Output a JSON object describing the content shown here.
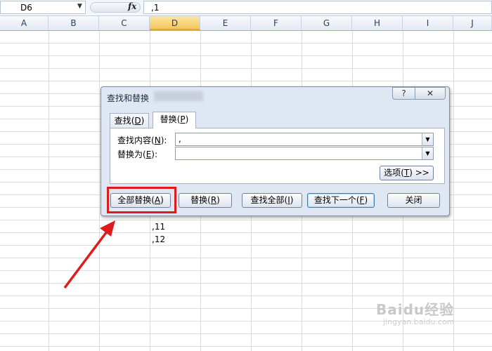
{
  "formula_bar": {
    "name_box": "D6",
    "fx_icon": "function-icon",
    "formula": ",1"
  },
  "columns": [
    "A",
    "B",
    "C",
    "D",
    "E",
    "F",
    "G",
    "H",
    "I",
    "J"
  ],
  "selected_column": "D",
  "cells": [
    ",11",
    ",12"
  ],
  "dialog": {
    "title": "查找和替换",
    "help": "?",
    "tabs": [
      {
        "label": "查找",
        "mnemonic": "D"
      },
      {
        "label": "替换",
        "mnemonic": "P"
      }
    ],
    "find_label": "查找内容",
    "find_mnemonic": "N",
    "find_value": ",",
    "replace_label": "替换为",
    "replace_mnemonic": "E",
    "replace_value": "",
    "options_label": "选项",
    "options_mnemonic": "T",
    "options_chevron": ">>",
    "buttons": {
      "replace_all": {
        "label": "全部替换",
        "mnemonic": "A"
      },
      "replace": {
        "label": "替换",
        "mnemonic": "R"
      },
      "find_all": {
        "label": "查找全部",
        "mnemonic": "I"
      },
      "find_next": {
        "label": "查找下一个",
        "mnemonic": "F"
      },
      "close": {
        "label": "关闭"
      }
    }
  },
  "annotation": {
    "color": "#e01b1b"
  },
  "watermark": {
    "text": "Baidu经验",
    "sub": "jingyan.baidu.com"
  }
}
